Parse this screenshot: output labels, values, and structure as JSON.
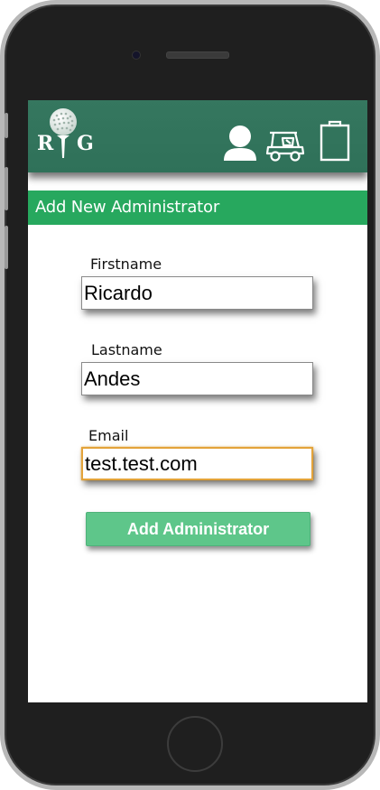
{
  "header": {
    "logo": {
      "letters": [
        "R",
        "G"
      ],
      "icon": "golf-ball-on-tee-icon"
    },
    "icons": [
      "user-profile-icon",
      "golf-cart-icon",
      "clipboard-icon"
    ]
  },
  "page": {
    "title": "Add New Administrator"
  },
  "form": {
    "firstname": {
      "label": "Firstname",
      "value": "Ricardo"
    },
    "lastname": {
      "label": "Lastname",
      "value": "Andes"
    },
    "email": {
      "label": "Email",
      "value": "test.test.com",
      "focused": true
    },
    "submit_label": "Add Administrator"
  },
  "colors": {
    "header": "#35775f",
    "subheader": "#27a85e",
    "button": "#5ec68a",
    "focus_border": "#e3a33a"
  }
}
